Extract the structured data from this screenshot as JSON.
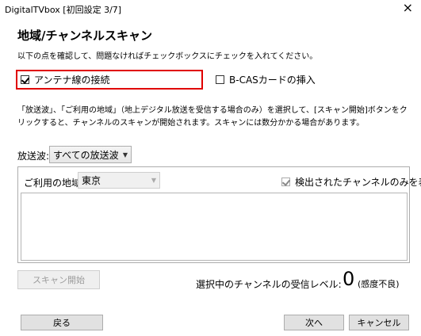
{
  "window": {
    "title": "DigitalTVbox [初回設定 3/7]",
    "close_glyph": "×"
  },
  "page": {
    "heading": "地域/チャンネルスキャン",
    "instruction": "以下の点を確認して、問題なければチェックボックスにチェックを入れてください。"
  },
  "checks": {
    "antenna_label": "アンテナ線の接続",
    "antenna_checked": true,
    "bcas_label": "B-CASカードの挿入",
    "bcas_checked": false
  },
  "description": "「放送波」、「ご利用の地域」（地上デジタル放送を受信する場合のみ）を選択して、[スキャン開始]ボタンをクリックすると、チャンネルのスキャンが開始されます。スキャンには数分かかる場合があります。",
  "broadcast": {
    "label": "放送波:",
    "selected": "すべての放送波"
  },
  "region": {
    "label": "ご利用の地域:",
    "selected": "東京",
    "detected_only_label": "検出されたチャンネルのみを表示",
    "detected_only_checked": true
  },
  "scan": {
    "button_label": "スキャン開始",
    "signal_label": "選択中のチャンネルの受信レベル:",
    "signal_value": "0",
    "signal_status": "(感度不良)"
  },
  "footer": {
    "back_label": "戻る",
    "next_label": "次へ",
    "cancel_label": "キャンセル"
  }
}
